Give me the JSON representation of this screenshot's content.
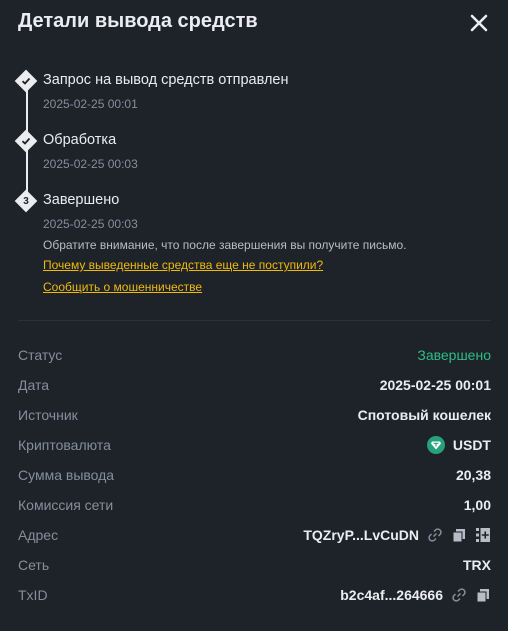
{
  "header": {
    "title": "Детали вывода средств"
  },
  "steps": [
    {
      "title": "Запрос на вывод средств отправлен",
      "time": "2025-02-25 00:01"
    },
    {
      "title": "Обработка",
      "time": "2025-02-25 00:03"
    },
    {
      "title": "Завершено",
      "time": "2025-02-25 00:03",
      "number": "3"
    }
  ],
  "note": "Обратите внимание, что после завершения вы получите письмо.",
  "links": {
    "not_received": "Почему выведенные средства еще не поступили?",
    "report_fraud": "Сообщить о мошенничестве"
  },
  "details": {
    "status": {
      "label": "Статус",
      "value": "Завершено"
    },
    "date": {
      "label": "Дата",
      "value": "2025-02-25 00:01"
    },
    "source": {
      "label": "Источник",
      "value": "Спотовый кошелек"
    },
    "crypto": {
      "label": "Криптовалюта",
      "value": "USDT"
    },
    "amount": {
      "label": "Сумма вывода",
      "value": "20,38"
    },
    "fee": {
      "label": "Комиссия сети",
      "value": "1,00"
    },
    "address": {
      "label": "Адрес",
      "value": "TQZryP...LvCuDN"
    },
    "network": {
      "label": "Сеть",
      "value": "TRX"
    },
    "txid": {
      "label": "TxID",
      "value": "b2c4af...264666"
    }
  },
  "colors": {
    "accent": "#f0b90b",
    "success": "#2ebd85",
    "background": "#1e2329",
    "muted": "#848e9c"
  },
  "icons": [
    "close-icon",
    "check-icon",
    "usdt-coin-icon",
    "link-icon",
    "copy-icon",
    "add-address-icon"
  ]
}
